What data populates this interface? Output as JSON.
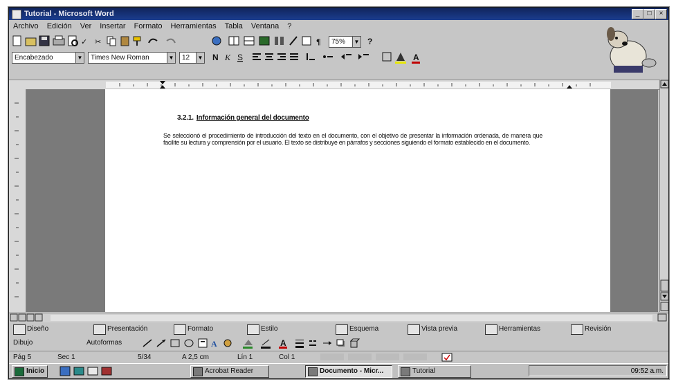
{
  "window": {
    "title": "Tutorial - Microsoft Word"
  },
  "menu": [
    "Archivo",
    "Edición",
    "Ver",
    "Insertar",
    "Formato",
    "Herramientas",
    "Tabla",
    "Ventana",
    "?"
  ],
  "format_toolbar": {
    "style": "Encabezado",
    "font": "Times New Roman",
    "size": "12",
    "zoom": "75%"
  },
  "document": {
    "heading_number": "3.2.1.",
    "heading_text": "Información general del documento",
    "paragraph": "Se seleccionó el procedimiento de introducción del texto en el documento, con el objetivo de presentar la información ordenada, de manera que facilite su lectura y comprensión por el usuario. El texto se distribuye en párrafos y secciones siguiendo el formato establecido en el documento."
  },
  "drawing_toolbar": {
    "draw_label": "Dibujo",
    "autoshapes_label": "Autoformas"
  },
  "bottom_toolbar": [
    "Diseño",
    "Presentación",
    "Formato",
    "Estilo",
    "Esquema",
    "Vista previa",
    "Herramientas",
    "Revisión"
  ],
  "status": {
    "page": "Pág 5",
    "section": "Sec 1",
    "position": "5/34",
    "at": "A 2,5 cm",
    "line": "Lín 1",
    "col": "Col 1"
  },
  "taskbar": {
    "start_label": "Inicio",
    "tasks": [
      "Acrobat Reader",
      "Documento - Micr...",
      "Tutorial"
    ],
    "clock": "09:52 a.m."
  }
}
